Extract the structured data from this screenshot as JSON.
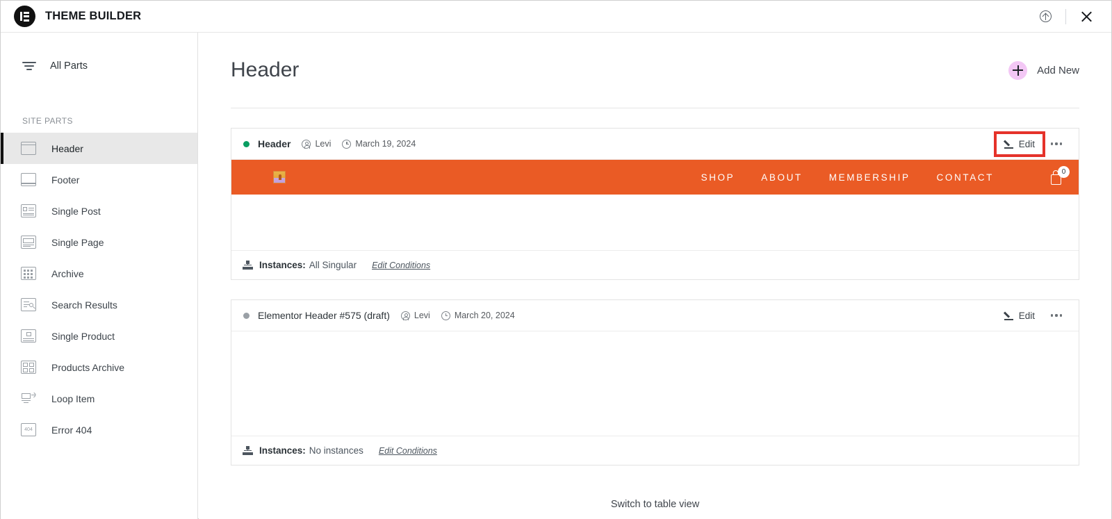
{
  "topbar": {
    "title": "THEME BUILDER",
    "logo_icon": "elementor-logo-icon",
    "help_icon": "circle-up-arrow-icon",
    "close_icon": "close-icon"
  },
  "sidebar": {
    "all_parts": {
      "label": "All Parts",
      "icon": "filter-icon"
    },
    "section_label": "SITE PARTS",
    "items": [
      {
        "label": "Header",
        "icon": "header-layout-icon",
        "active": true
      },
      {
        "label": "Footer",
        "icon": "footer-layout-icon",
        "active": false
      },
      {
        "label": "Single Post",
        "icon": "single-post-icon",
        "active": false
      },
      {
        "label": "Single Page",
        "icon": "single-page-icon",
        "active": false
      },
      {
        "label": "Archive",
        "icon": "archive-grid-icon",
        "active": false
      },
      {
        "label": "Search Results",
        "icon": "search-results-icon",
        "active": false
      },
      {
        "label": "Single Product",
        "icon": "single-product-icon",
        "active": false
      },
      {
        "label": "Products Archive",
        "icon": "products-archive-icon",
        "active": false
      },
      {
        "label": "Loop Item",
        "icon": "loop-item-icon",
        "active": false
      },
      {
        "label": "Error 404",
        "icon": "error-404-icon",
        "active": false
      }
    ]
  },
  "main": {
    "page_title": "Header",
    "add_new": {
      "label": "Add New",
      "icon": "plus-circle-icon",
      "color": "#f3c7f5"
    },
    "switch_view_label": "Switch to table view",
    "cards": [
      {
        "name": "Header",
        "status": "published",
        "status_color": "#0a9e62",
        "author": "Levi",
        "date": "March 19, 2024",
        "edit_label": "Edit",
        "edit_highlighted": true,
        "highlight_color": "#e5322a",
        "instances_label": "Instances:",
        "instances_value": "All Singular",
        "edit_conditions_label": "Edit Conditions",
        "preview": {
          "type": "site-header",
          "background": "#ea5b25",
          "logo_icon": "site-logo-thumbnail",
          "nav_links": [
            "SHOP",
            "ABOUT",
            "MEMBERSHIP",
            "CONTACT"
          ],
          "cart_icon": "shopping-bag-icon",
          "cart_count": "0"
        }
      },
      {
        "name": "Elementor Header #575 (draft)",
        "status": "draft",
        "status_color": "#9aa0a6",
        "author": "Levi",
        "date": "March 20, 2024",
        "edit_label": "Edit",
        "edit_highlighted": false,
        "instances_label": "Instances:",
        "instances_value": "No instances",
        "edit_conditions_label": "Edit Conditions",
        "preview": {
          "type": "blank"
        }
      }
    ]
  }
}
